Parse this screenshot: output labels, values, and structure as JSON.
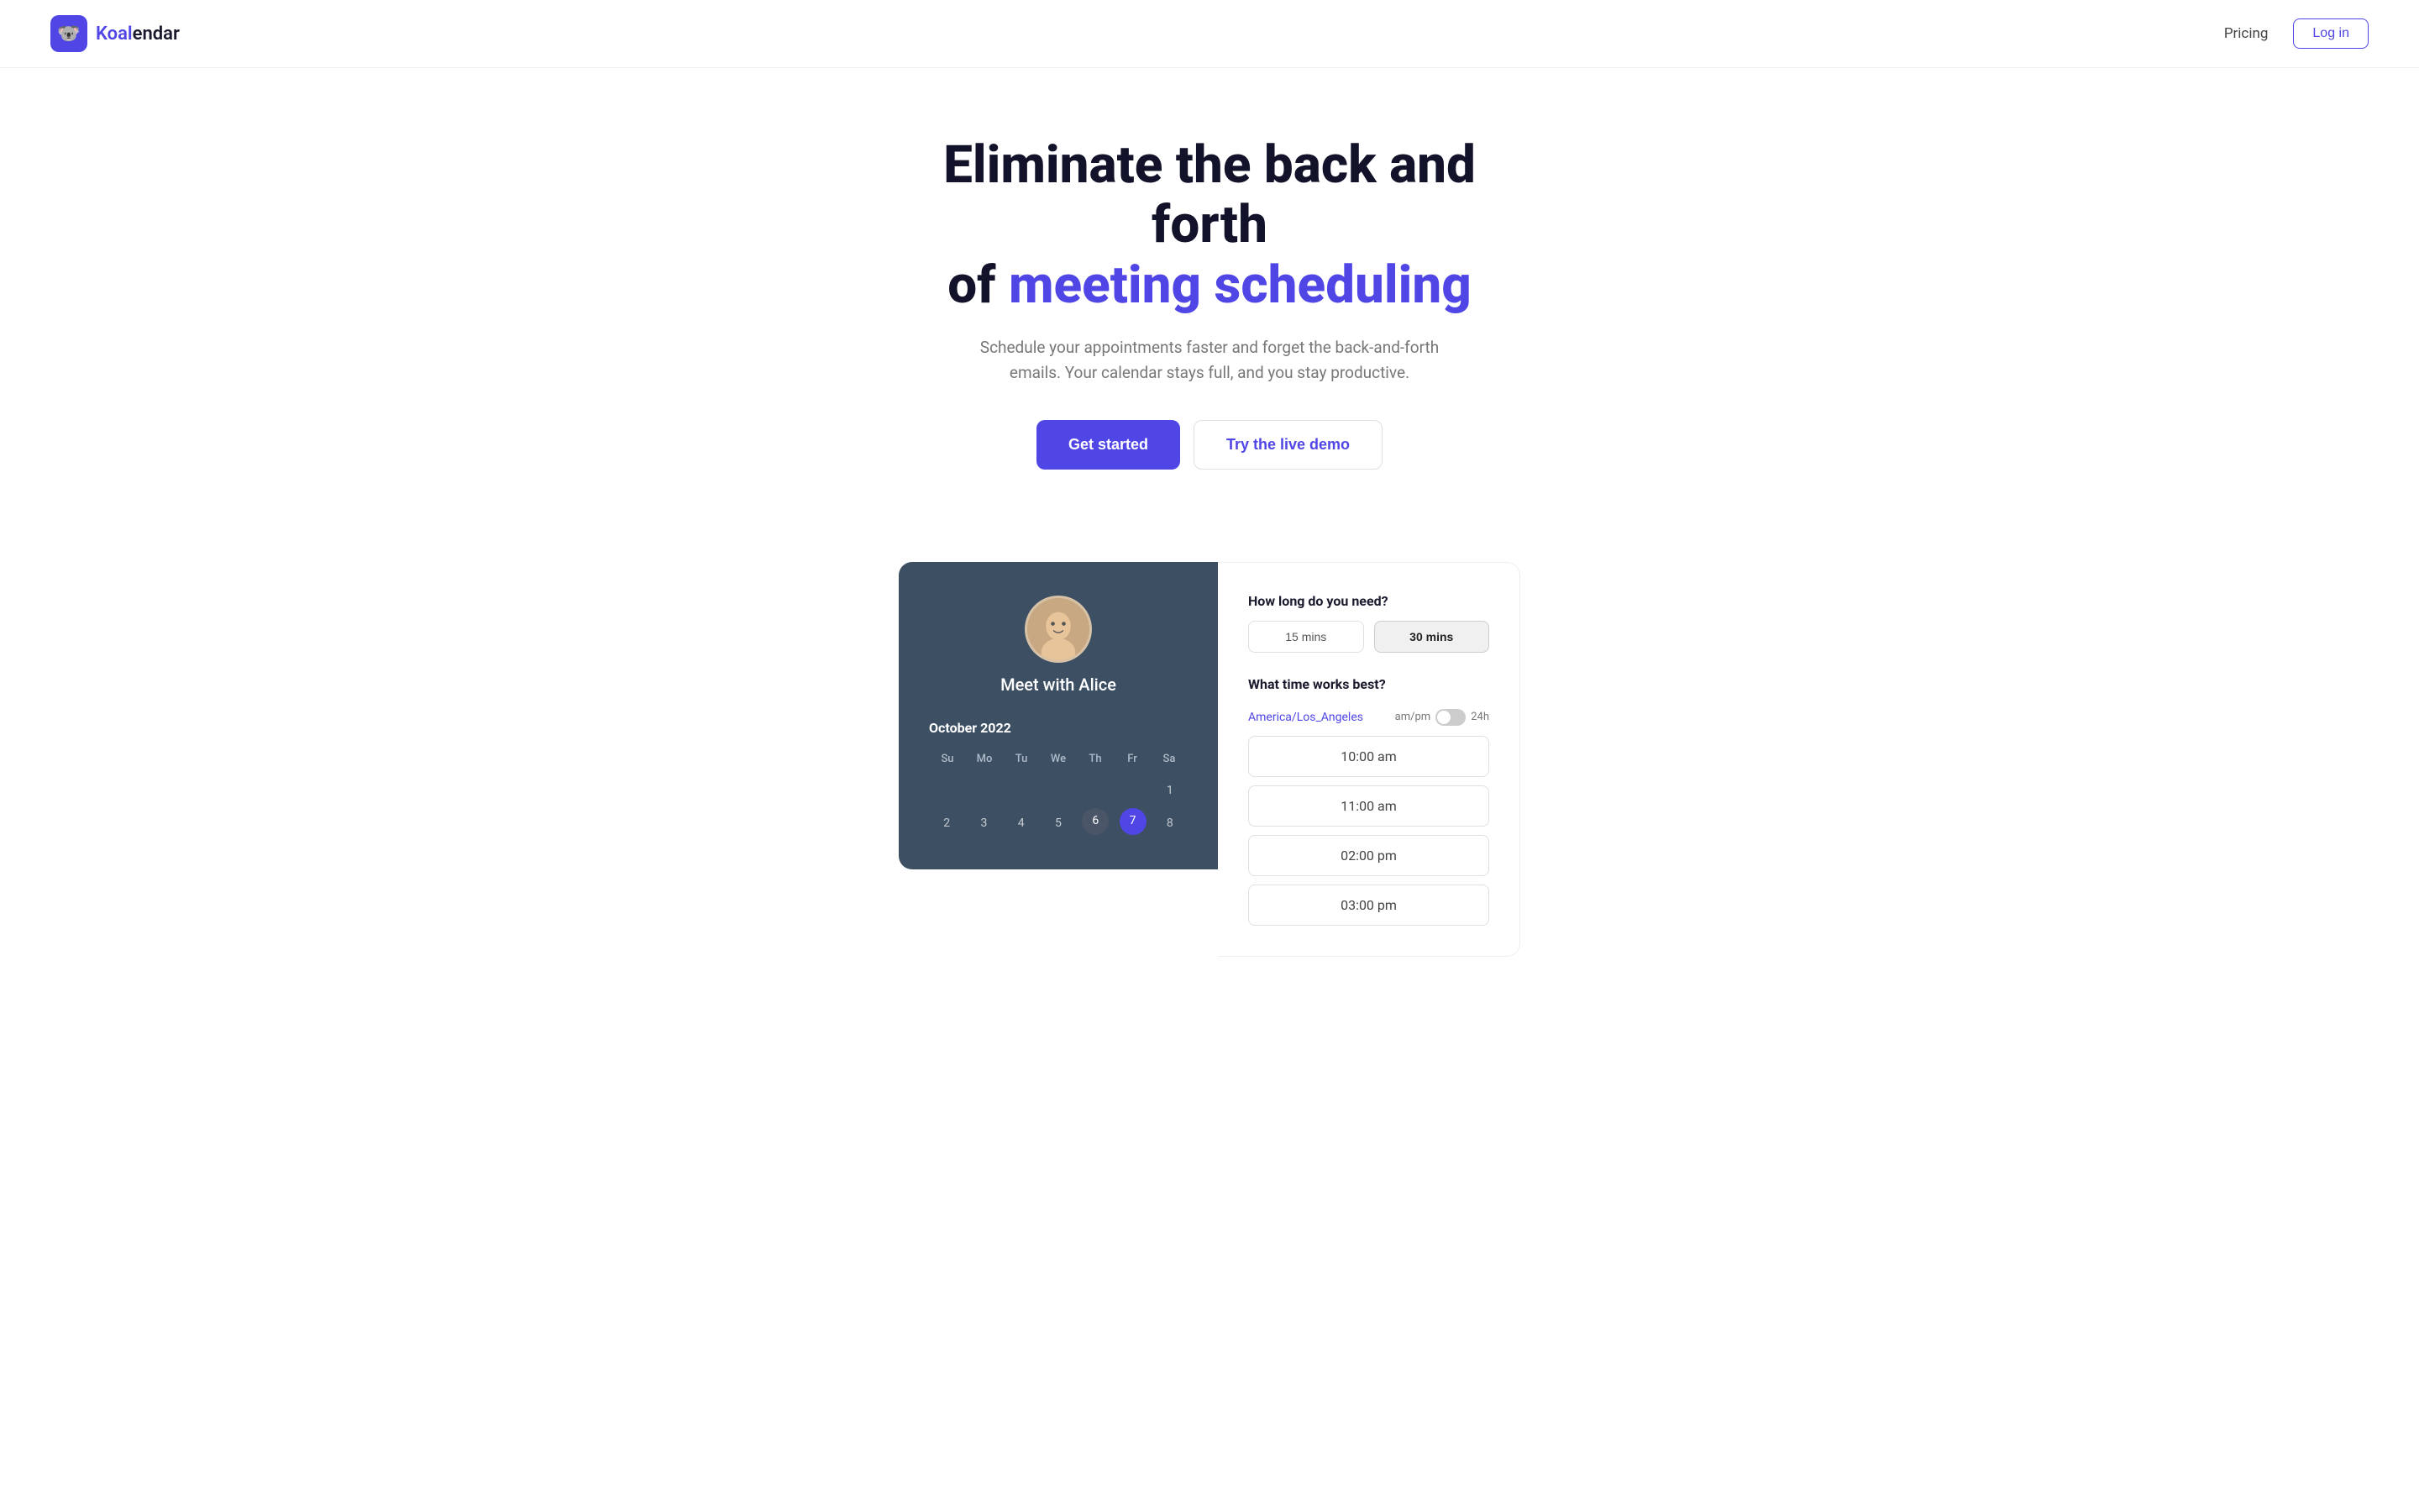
{
  "navbar": {
    "logo_icon": "🐨",
    "logo_text_bold": "Koal",
    "logo_text_rest": "endar",
    "pricing_label": "Pricing",
    "login_label": "Log in"
  },
  "hero": {
    "title_line1": "Eliminate the back and forth",
    "title_line2_plain": "of ",
    "title_line2_accent": "meeting scheduling",
    "subtitle": "Schedule your appointments faster and forget the back-and-forth emails. Your calendar stays full, and you stay productive.",
    "btn_primary": "Get started",
    "btn_secondary": "Try the live demo"
  },
  "calendar": {
    "profile_name": "Meet with Alice",
    "month": "October 2022",
    "day_headers": [
      "Su",
      "Mo",
      "Tu",
      "We",
      "Th",
      "Fr",
      "Sa"
    ],
    "days": [
      "",
      "",
      "",
      "",
      "",
      "",
      "1",
      "2",
      "3",
      "4",
      "5",
      "6",
      "7",
      "8"
    ],
    "selected_days": [
      "6",
      "7"
    ]
  },
  "schedule": {
    "duration_label": "How long do you need?",
    "duration_options": [
      {
        "label": "15 mins",
        "active": false
      },
      {
        "label": "30 mins",
        "active": true
      }
    ],
    "time_label": "What time works best?",
    "timezone": "America/Los_Angeles",
    "ampm": "am/pm",
    "format_24": "24h",
    "time_slots": [
      "10:00 am",
      "11:00 am",
      "02:00 pm",
      "03:00 pm"
    ]
  }
}
